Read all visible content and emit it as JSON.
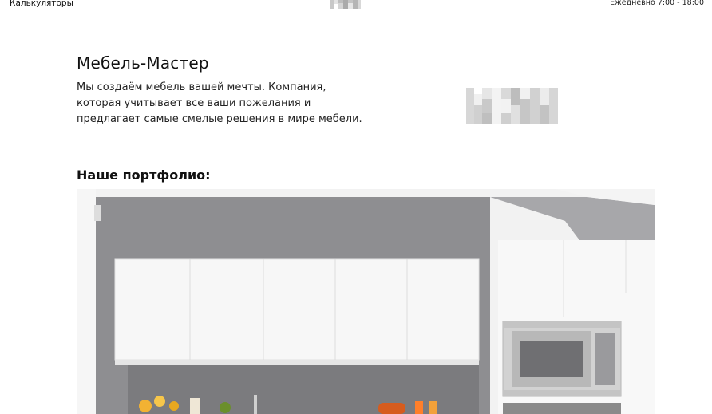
{
  "header": {
    "nav_link": "Калькуляторы",
    "hours": "Ежедневно 7:00 - 18:00",
    "logo_icon": "pixelated-logo-icon"
  },
  "intro": {
    "title": "Мебель-Мастер",
    "description": "Мы создаём мебель вашей мечты. Компания, которая учитывает все ваши пожелания и предлагает самые смелые решения в мире мебели.",
    "logo_icon": "pixelated-logo-icon"
  },
  "portfolio": {
    "title": "Наше портфолио:"
  },
  "colors": {
    "wall": "#8c8c8f",
    "cabinet": "#f7f7f7",
    "backsplash": "#7b7b7e",
    "stainless": "#c9c9c9"
  }
}
